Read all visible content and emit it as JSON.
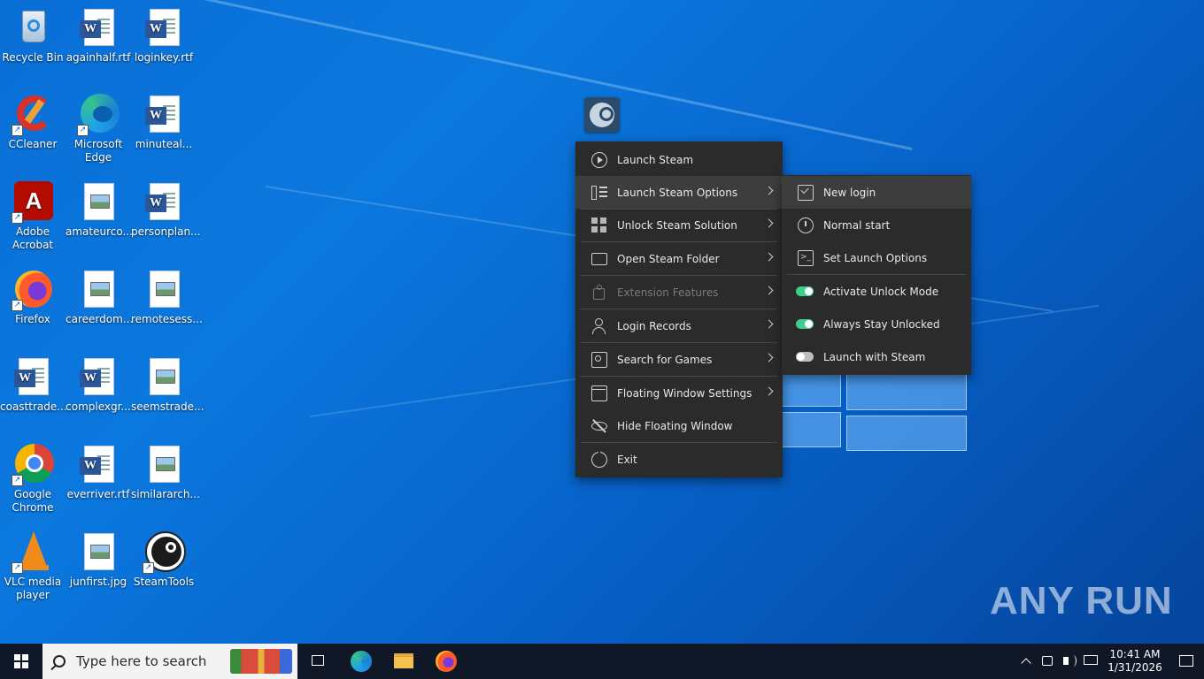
{
  "desktop_icons": [
    {
      "label": "Recycle Bin",
      "icon": "recycle-bin-icon"
    },
    {
      "label": "againhalf.rtf",
      "icon": "word-document-icon"
    },
    {
      "label": "loginkey.rtf",
      "icon": "word-document-icon"
    },
    {
      "label": "CCleaner",
      "icon": "ccleaner-icon"
    },
    {
      "label": "Microsoft Edge",
      "icon": "edge-icon"
    },
    {
      "label": "minuteal...",
      "icon": "word-document-icon"
    },
    {
      "label": "Adobe Acrobat",
      "icon": "acrobat-icon"
    },
    {
      "label": "amateurco...",
      "icon": "image-file-icon"
    },
    {
      "label": "personplan...",
      "icon": "word-document-icon"
    },
    {
      "label": "Firefox",
      "icon": "firefox-icon"
    },
    {
      "label": "careerdom...",
      "icon": "image-file-icon"
    },
    {
      "label": "remotesess...",
      "icon": "image-file-icon"
    },
    {
      "label": "coasttrade...",
      "icon": "word-document-icon"
    },
    {
      "label": "complexgr...",
      "icon": "word-document-icon"
    },
    {
      "label": "seemstrade...",
      "icon": "image-file-icon"
    },
    {
      "label": "Google Chrome",
      "icon": "chrome-icon"
    },
    {
      "label": "everriver.rtf",
      "icon": "word-document-icon"
    },
    {
      "label": "similararch...",
      "icon": "image-file-icon"
    },
    {
      "label": "VLC media player",
      "icon": "vlc-icon"
    },
    {
      "label": "junfirst.jpg",
      "icon": "image-file-icon"
    },
    {
      "label": "SteamTools",
      "icon": "steam-icon"
    }
  ],
  "main_menu": {
    "items": [
      {
        "label": "Launch Steam",
        "icon": "play-circle-icon"
      },
      {
        "label": "Launch Steam Options",
        "icon": "options-list-icon"
      },
      {
        "label": "Unlock Steam Solution",
        "icon": "grid-icon"
      },
      {
        "label": "Open Steam Folder",
        "icon": "folder-icon"
      },
      {
        "label": "Extension Features",
        "icon": "puzzle-icon"
      },
      {
        "label": "Login Records",
        "icon": "user-icon"
      },
      {
        "label": "Search for Games",
        "icon": "search-box-icon"
      },
      {
        "label": "Floating Window Settings",
        "icon": "window-settings-icon"
      },
      {
        "label": "Hide Floating Window",
        "icon": "eye-off-icon"
      },
      {
        "label": "Exit",
        "icon": "power-icon"
      }
    ]
  },
  "sub_menu": {
    "items": [
      {
        "label": "New login",
        "icon": "checkbox-icon"
      },
      {
        "label": "Normal start",
        "icon": "stopwatch-icon"
      },
      {
        "label": "Set Launch Options",
        "icon": "terminal-icon"
      },
      {
        "label": "Activate Unlock Mode",
        "toggle": "on"
      },
      {
        "label": "Always Stay Unlocked",
        "toggle": "on"
      },
      {
        "label": "Launch with Steam",
        "toggle": "off"
      }
    ]
  },
  "taskbar": {
    "search_placeholder": "Type here to search",
    "time": "10:41 AM",
    "date": "1/31/2026"
  },
  "watermark": "ANY RUN",
  "colors": {
    "accent_toggle": "#3ecf8e",
    "menu_bg": "#2b2b2b",
    "taskbar": "#101828"
  }
}
